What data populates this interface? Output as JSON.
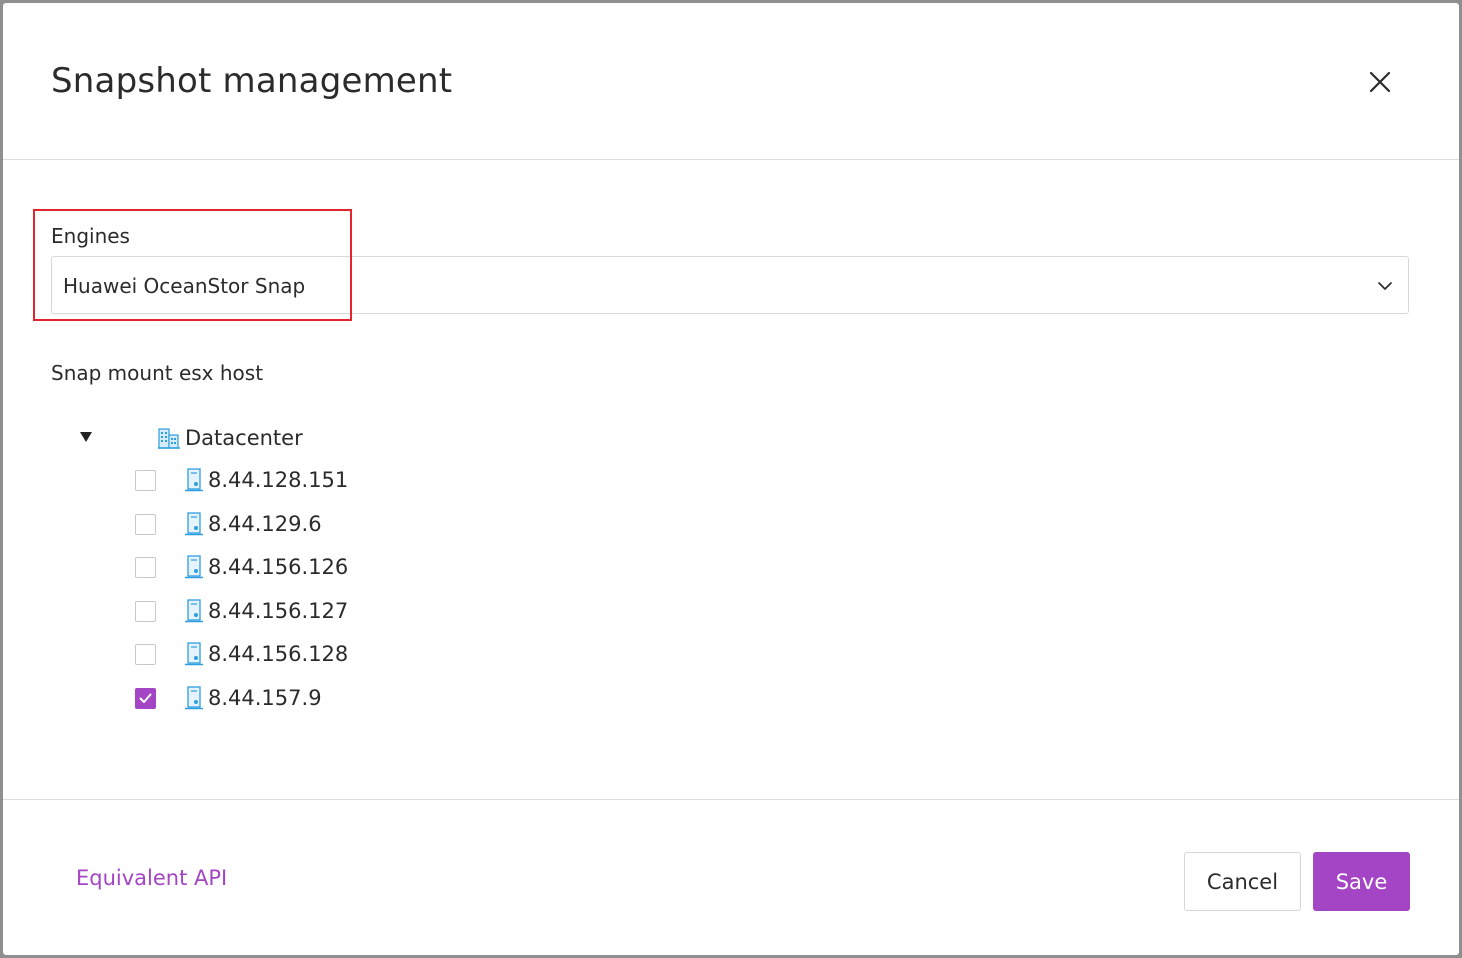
{
  "dialog": {
    "title": "Snapshot management"
  },
  "engines": {
    "label": "Engines",
    "selected": "Huawei OceanStor Snap"
  },
  "snap_mount": {
    "label": "Snap mount esx host",
    "tree": {
      "root_label": "Datacenter",
      "expanded": true,
      "hosts": [
        {
          "label": "8.44.128.151",
          "checked": false
        },
        {
          "label": "8.44.129.6",
          "checked": false
        },
        {
          "label": "8.44.156.126",
          "checked": false
        },
        {
          "label": "8.44.156.127",
          "checked": false
        },
        {
          "label": "8.44.156.128",
          "checked": false
        },
        {
          "label": "8.44.157.9",
          "checked": true
        }
      ]
    }
  },
  "footer": {
    "api_link": "Equivalent API",
    "cancel_label": "Cancel",
    "save_label": "Save"
  },
  "colors": {
    "accent": "#a445c5",
    "highlight": "#e3262b",
    "icon_blue": "#2f9ee0"
  },
  "icons": {
    "close": "close-icon",
    "dropdown": "chevron-down-icon",
    "tree_toggle": "caret-down-icon",
    "datacenter": "datacenter-icon",
    "host": "esx-host-icon",
    "check": "check-icon"
  }
}
